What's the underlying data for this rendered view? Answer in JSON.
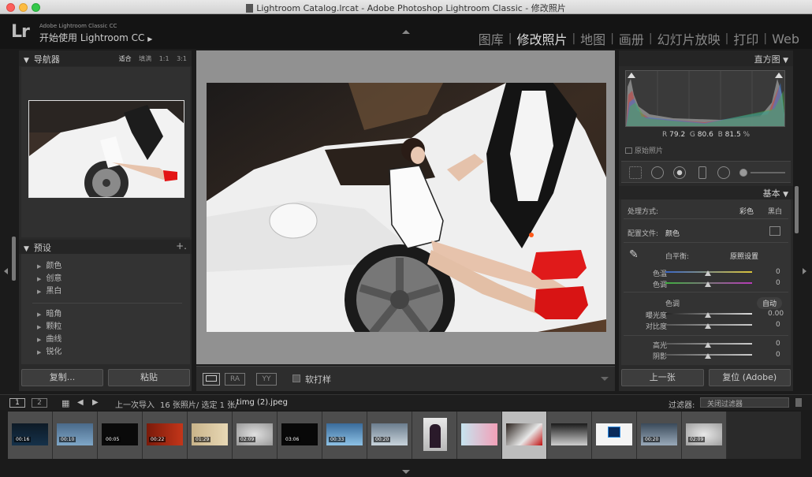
{
  "window": {
    "title": "Lightroom Catalog.lrcat - Adobe Photoshop Lightroom Classic - 修改照片"
  },
  "header": {
    "logo": "Lr",
    "app_name": "Adobe Lightroom Classic CC",
    "start_label": "开始使用 Lightroom CC",
    "start_arrow": "▶",
    "modules": [
      "图库",
      "修改照片",
      "地图",
      "画册",
      "幻灯片放映",
      "打印",
      "Web"
    ]
  },
  "navigator": {
    "title": "导航器",
    "options": [
      "适合",
      "填满",
      "1:1",
      "3:1"
    ]
  },
  "presets": {
    "title": "预设",
    "plus": "+.",
    "group1": [
      "颜色",
      "创意",
      "黑白"
    ],
    "group2": [
      "暗角",
      "颗粒",
      "曲线",
      "锐化"
    ]
  },
  "left_buttons": {
    "copy": "复制...",
    "paste": "粘贴"
  },
  "toolbar": {
    "ra": "RA",
    "yy": "YY",
    "soft_proof": "软打样"
  },
  "histogram": {
    "title": "直方图",
    "r_label": "R",
    "r_value": "79.2",
    "g_label": "G",
    "g_value": "80.6",
    "b_label": "B",
    "b_value": "81.5",
    "percent": "%",
    "original": "原始照片"
  },
  "basic": {
    "title": "基本",
    "treatment_label": "处理方式:",
    "color": "彩色",
    "bw": "黑白",
    "profile_label": "配置文件:",
    "profile_value": "颜色",
    "wb_label": "白平衡:",
    "wb_value": "原照设置",
    "temp_label": "色温",
    "temp_value": "0",
    "tint_label": "色调",
    "tint_value": "0",
    "tone_label": "色调",
    "auto": "自动",
    "exposure_label": "曝光度",
    "exposure_value": "0.00",
    "contrast_label": "对比度",
    "contrast_value": "0",
    "highlights_label": "高光",
    "highlights_value": "0",
    "shadows_label": "阴影",
    "shadows_value": "0"
  },
  "right_buttons": {
    "prev": "上一张",
    "reset": "复位 (Adobe)"
  },
  "filmstrip_bar": {
    "page1": "1",
    "page2": "2",
    "source": "上一次导入",
    "count": "16 张照片/ 选定 1 张/",
    "filename": "timg (2).jpeg",
    "filter_label": "过滤器:",
    "filter_value": "关闭过滤器"
  },
  "filmstrip": [
    {
      "badge": "00:16"
    },
    {
      "badge": "00:10"
    },
    {
      "badge": "00:05"
    },
    {
      "badge": "00:22"
    },
    {
      "badge": "01:29"
    },
    {
      "badge": "02:09"
    },
    {
      "badge": "03:06"
    },
    {
      "badge": "00:33"
    },
    {
      "badge": "00:20"
    },
    {
      "badge": ""
    },
    {
      "badge": ""
    },
    {
      "badge": ""
    },
    {
      "badge": ""
    },
    {
      "badge": ""
    },
    {
      "badge": "00:20"
    },
    {
      "badge": "02:09"
    }
  ]
}
